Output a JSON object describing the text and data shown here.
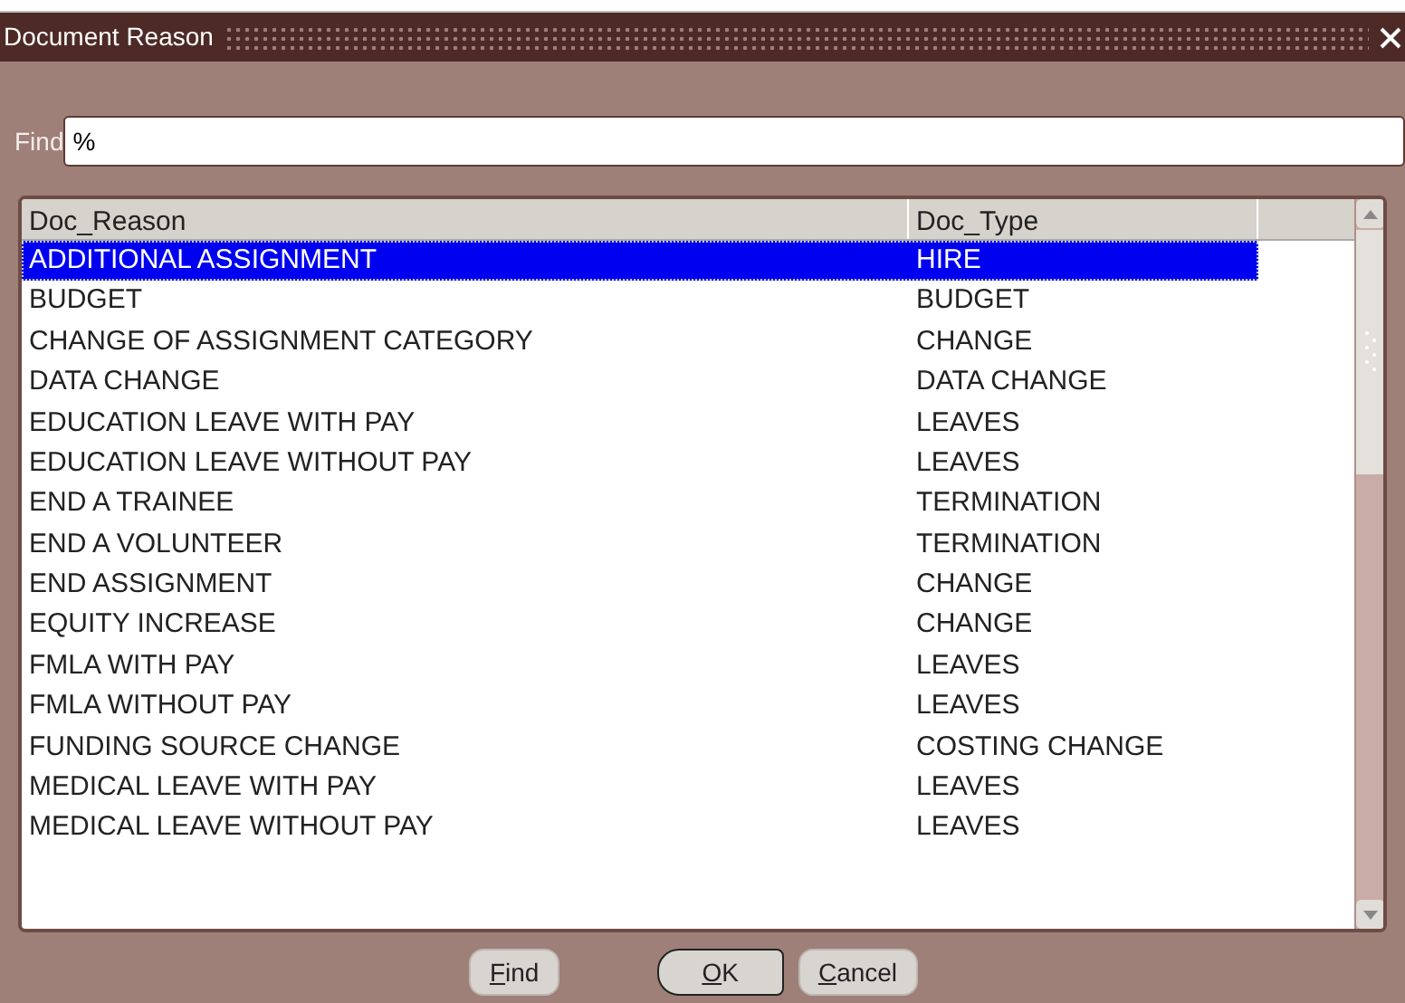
{
  "window": {
    "title": "Document Reason"
  },
  "find": {
    "label": "Find",
    "value": "%"
  },
  "table": {
    "columns": [
      "Doc_Reason",
      "Doc_Type"
    ],
    "rows": [
      {
        "cells": [
          "ADDITIONAL ASSIGNMENT",
          "HIRE"
        ],
        "selected": true
      },
      {
        "cells": [
          "BUDGET",
          "BUDGET"
        ],
        "selected": false
      },
      {
        "cells": [
          "CHANGE OF ASSIGNMENT CATEGORY",
          "CHANGE"
        ],
        "selected": false
      },
      {
        "cells": [
          "DATA CHANGE",
          "DATA CHANGE"
        ],
        "selected": false
      },
      {
        "cells": [
          "EDUCATION LEAVE WITH PAY",
          "LEAVES"
        ],
        "selected": false
      },
      {
        "cells": [
          "EDUCATION LEAVE WITHOUT PAY",
          "LEAVES"
        ],
        "selected": false
      },
      {
        "cells": [
          "END A TRAINEE",
          "TERMINATION"
        ],
        "selected": false
      },
      {
        "cells": [
          "END A VOLUNTEER",
          "TERMINATION"
        ],
        "selected": false
      },
      {
        "cells": [
          "END ASSIGNMENT",
          "CHANGE"
        ],
        "selected": false
      },
      {
        "cells": [
          "EQUITY INCREASE",
          "CHANGE"
        ],
        "selected": false
      },
      {
        "cells": [
          "FMLA WITH PAY",
          "LEAVES"
        ],
        "selected": false
      },
      {
        "cells": [
          "FMLA WITHOUT PAY",
          "LEAVES"
        ],
        "selected": false
      },
      {
        "cells": [
          "FUNDING SOURCE CHANGE",
          "COSTING CHANGE"
        ],
        "selected": false
      },
      {
        "cells": [
          "MEDICAL LEAVE WITH PAY",
          "LEAVES"
        ],
        "selected": false
      },
      {
        "cells": [
          "MEDICAL LEAVE WITHOUT PAY",
          "LEAVES"
        ],
        "selected": false
      }
    ]
  },
  "buttons": [
    {
      "label": "Find",
      "underline_first": true,
      "default": false
    },
    {
      "label": "OK",
      "underline_first": true,
      "default": true
    },
    {
      "label": "Cancel",
      "underline_first": true,
      "default": false
    }
  ]
}
